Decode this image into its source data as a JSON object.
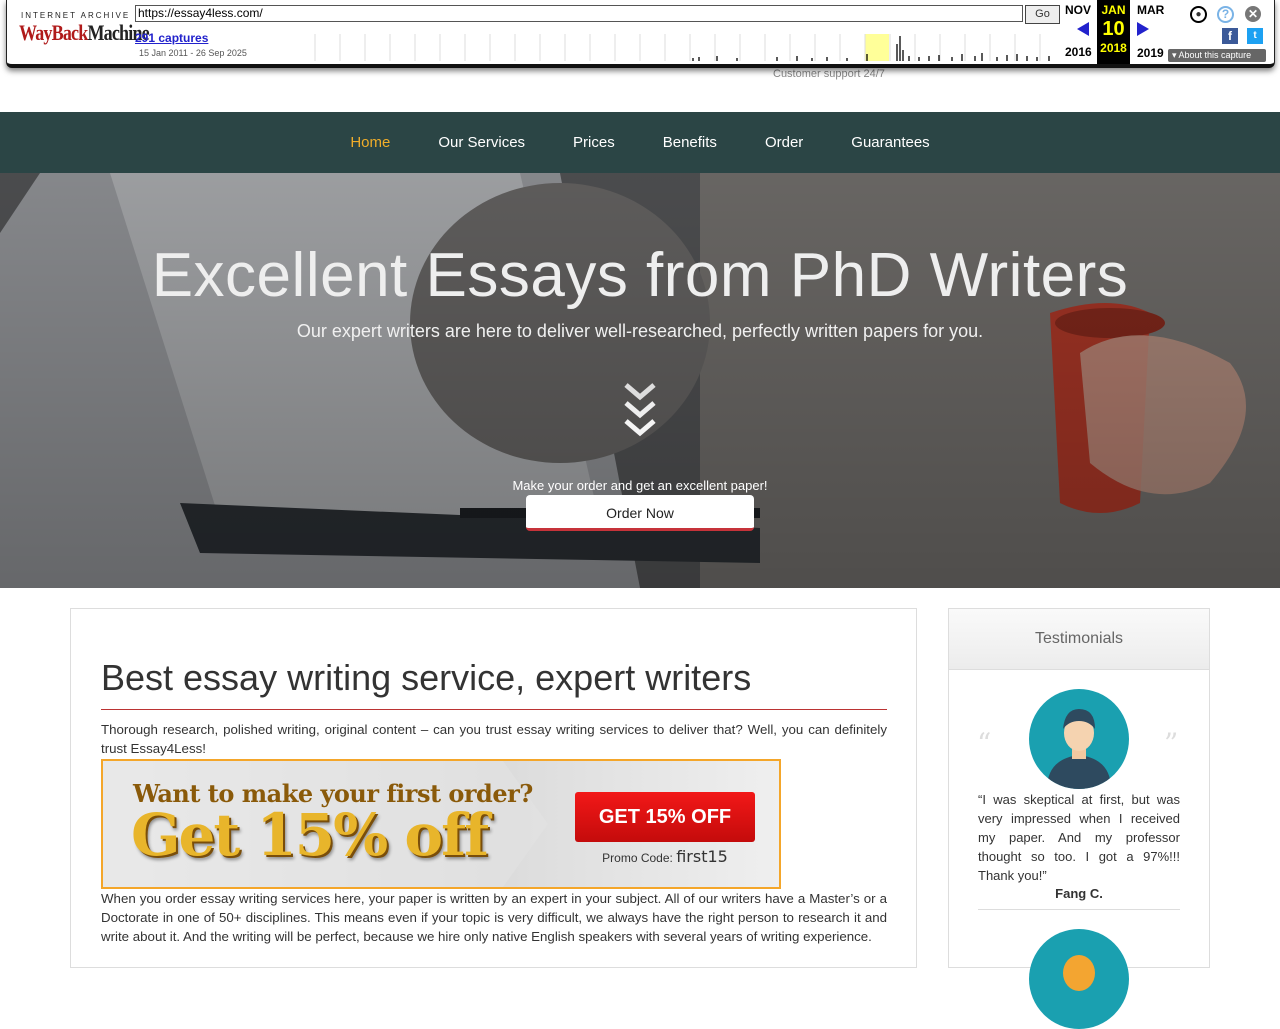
{
  "wayback": {
    "brand_top": "INTERNET ARCHIVE",
    "brand_wayback": "WayBack",
    "brand_machine": "Machine",
    "url": "https://essay4less.com/",
    "go_label": "Go",
    "captures": "291 captures",
    "range": "15 Jan 2011 - 26 Sep 2025",
    "prev_month": "NOV",
    "prev_year": "2016",
    "cur_month": "JAN",
    "cur_day": "10",
    "cur_year": "2018",
    "next_month": "MAR",
    "next_year": "2019",
    "about": "About this capture",
    "colors": {
      "highlight": "#ffff99",
      "current_bg": "#000000",
      "current_text": "#ffff00"
    }
  },
  "header": {
    "support": "Customer support 24/7"
  },
  "nav": {
    "items": [
      "Home",
      "Our Services",
      "Prices",
      "Benefits",
      "Order",
      "Guarantees"
    ],
    "active": "Home",
    "colors": {
      "bg": "#2b4545",
      "active": "#f0ad2a"
    }
  },
  "hero": {
    "title": "Excellent Essays from PhD Writers",
    "subtitle": "Our expert writers are here to deliver well-researched, perfectly written papers for you.",
    "cta_text": "Make your order and get an excellent paper!",
    "order_button": "Order Now"
  },
  "main": {
    "heading": "Best essay writing service, expert writers",
    "intro": "Thorough research, polished writing, original content – can you trust essay writing services to deliver that? Well, you can definitely trust Essay4Less!",
    "promo": {
      "question": "Want to make your first order?",
      "headline": "Get 15% off",
      "button": "GET 15% OFF",
      "code_label": "Promo Code:",
      "code": "first15"
    },
    "body": "When you order essay writing services here, your paper is written by an expert in your subject. All of our writers have a Master’s or a Doctorate in one of 50+ disciplines. This means even if your topic is very difficult, we always have the right person to research it and write about it. And the writing will be perfect, because we hire only native English speakers with several years of writing experience."
  },
  "testimonials": {
    "title": "Testimonials",
    "items": [
      {
        "text": "“I was skeptical at first, but was very impressed when I received my paper. And my professor thought so too. I got a 97%!!! Thank you!”",
        "name": "Fang C."
      }
    ]
  }
}
